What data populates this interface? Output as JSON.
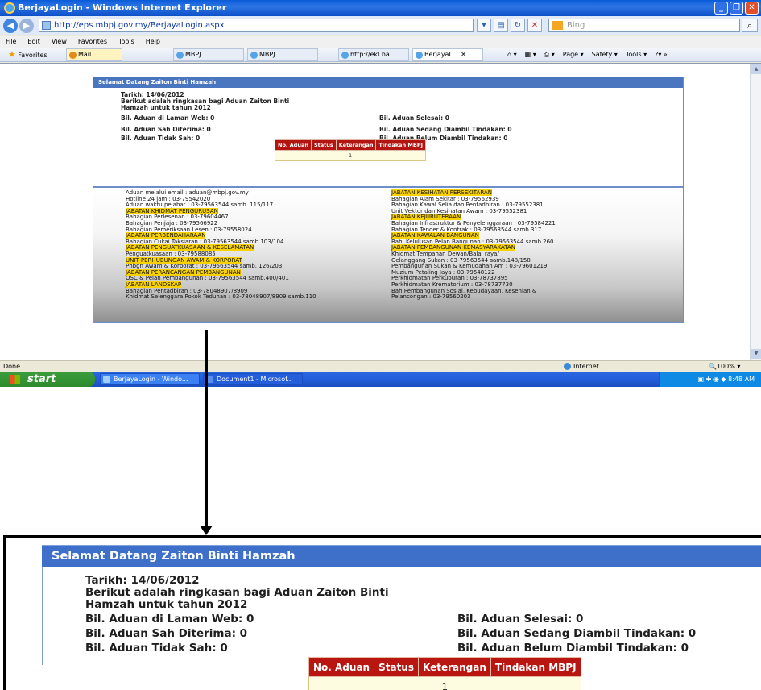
{
  "window": {
    "title": "BerjayaLogin - Windows Internet Explorer",
    "url": "http://eps.mbpj.gov.my/BerjayaLogin.aspx",
    "search_placeholder": "Bing",
    "menu": [
      "File",
      "Edit",
      "View",
      "Favorites",
      "Tools",
      "Help"
    ],
    "favorites_label": "Favorites",
    "favorites_item": "Mail",
    "tabs": [
      "MBPJ",
      "MBPJ",
      "http://ekl.ha...",
      "BerjayaL..."
    ],
    "commands": [
      "Page ▾",
      "Safety ▾",
      "Tools ▾"
    ],
    "status": "Done",
    "zone": "Internet",
    "zoom": "100%"
  },
  "taskbar": {
    "start": "start",
    "items": [
      "BerjayaLogin - Windo...",
      "Document1 - Microsof..."
    ],
    "clock": "8:48 AM"
  },
  "page": {
    "welcome": "Selamat Datang Zaiton Binti Hamzah",
    "date": "Tarikh: 14/06/2012",
    "summary_line1": "Berikut adalah ringkasan bagi Aduan Zaiton Binti",
    "summary_line2": "Hamzah untuk tahun 2012",
    "stats": {
      "web": "Bil. Aduan di Laman Web: 0",
      "selesai": "Bil. Aduan Selesai: 0",
      "sah": "Bil. Aduan Sah Diterima: 0",
      "sedang": "Bil. Aduan Sedang Diambil Tindakan: 0",
      "tidak_sah": "Bil. Aduan Tidak Sah: 0",
      "belum": "Bil. Aduan Belum Diambil Tindakan: 0"
    },
    "table": {
      "headers": [
        "No. Aduan",
        "Status",
        "Keterangan",
        "Tindakan MBPJ"
      ],
      "row": "1"
    }
  },
  "contacts": {
    "left": [
      {
        "t": "Aduan melalui email : aduan@mbpj.gov.my",
        "h": false
      },
      {
        "t": "Hotline 24 jam : 03-79542020",
        "h": false
      },
      {
        "t": "Aduan waktu pejabat : 03-79563544 samb. 115/117",
        "h": false
      },
      {
        "t": "JABATAN KHIDMAT PENGURUSAN",
        "h": true
      },
      {
        "t": "Bahagian Perlesenan : 03-79604467",
        "h": false
      },
      {
        "t": "Bahagian Penjaja : 03-79566922",
        "h": false
      },
      {
        "t": "Bahagian Pemeriksaan Lesen : 03-79558024",
        "h": false
      },
      {
        "t": "JABATAN PERBENDAHARAAN",
        "h": true
      },
      {
        "t": "Bahagian Cukai Taksiaran : 03-79563544 samb.103/104",
        "h": false
      },
      {
        "t": "JABATAN PENGUATKUASAAN & KESELAMATAN",
        "h": true
      },
      {
        "t": "Penguatkuasaan : 03-79588085",
        "h": false
      },
      {
        "t": "UNIT PERHUBUNGAN AWAM & KORPORAT",
        "h": true
      },
      {
        "t": "Phbgn Awam & Korporat : 03-79563544 samb. 126/203",
        "h": false
      },
      {
        "t": "JABATAN PERANCANGAN PEMBANGUNAN",
        "h": true
      },
      {
        "t": "OSC & Pelan Pembangunan : 03-79563544 samb.400/401",
        "h": false
      },
      {
        "t": "JABATAN LANDSKAP",
        "h": true
      },
      {
        "t": "Bahagian Pentadbiran : 03-78048907/8909",
        "h": false
      },
      {
        "t": "Khidmat Selenggara Pokok Teduhan : 03-78048907/8909 samb.110",
        "h": false
      }
    ],
    "right": [
      {
        "t": "JABATAN KESIHATAN PERSEKITARAN",
        "h": true
      },
      {
        "t": "Bahagian Alam Sekitar : 03-79562939",
        "h": false
      },
      {
        "t": "Bahagian Kawal Selia dan Pentadbiran : 03-79552381",
        "h": false
      },
      {
        "t": "Unit Vektor dan Kesihatan Awam : 03-79552381",
        "h": false
      },
      {
        "t": "JABATAN KEJURUTERAAN",
        "h": true
      },
      {
        "t": "Bahagian Infrastruktur & Penyelenggaraan : 03-79584221",
        "h": false
      },
      {
        "t": "Bahagian Tender & Kontrak : 03-79563544 samb.317",
        "h": false
      },
      {
        "t": "JABATAN KAWALAN BANGUNAN",
        "h": true
      },
      {
        "t": "Bah. Kelulusan Pelan Bangunan : 03-79563544 samb.260",
        "h": false
      },
      {
        "t": "JABATAN PEMBANGUNAN KEMASYARAKATAN",
        "h": true
      },
      {
        "t": "Khidmat Tempahan Dewan/Balai raya/",
        "h": false
      },
      {
        "t": "Gelanggang Sukan : 03-79563544 samb.148/158",
        "h": false
      },
      {
        "t": "Pembangunan Sukan & Kemudahan Am : 03-79601219",
        "h": false
      },
      {
        "t": "Muzium Petaling Jaya : 03-79548122",
        "h": false
      },
      {
        "t": "Perkhidmatan Perkuburan : 03-78737895",
        "h": false
      },
      {
        "t": "Perkhidmatan Krematorium : 03-78737730",
        "h": false
      },
      {
        "t": "Bah.Pembangunan Sosial, Kebudayaan, Kesenian &",
        "h": false
      },
      {
        "t": "Pelancongan : 03-79560203",
        "h": false
      }
    ]
  }
}
